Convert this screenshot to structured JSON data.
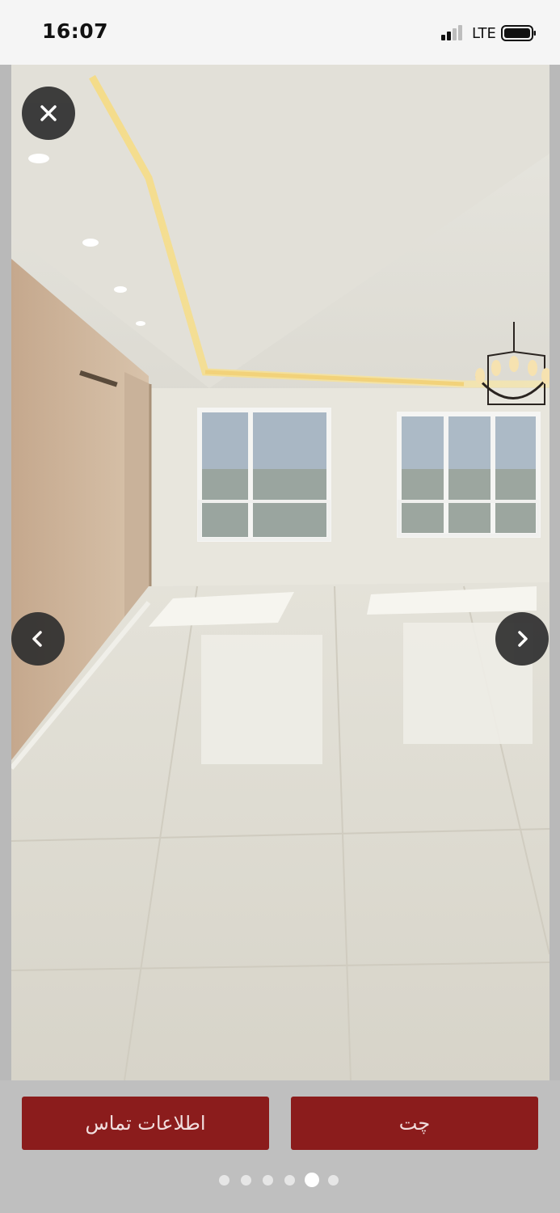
{
  "status_bar": {
    "time": "16:07",
    "network": "LTE",
    "signal_icon": "cellular-signal-icon",
    "battery_icon": "battery-icon"
  },
  "viewer": {
    "photo_description_icon": "listing-photo",
    "close_icon": "close-icon",
    "prev_icon": "chevron-left-icon",
    "next_icon": "chevron-right-icon"
  },
  "actions": {
    "contact_label": "اطلاعات تماس",
    "chat_label": "چت",
    "accent_color": "#8b1c1c"
  },
  "pagination": {
    "total": 6,
    "active_index": 4
  }
}
